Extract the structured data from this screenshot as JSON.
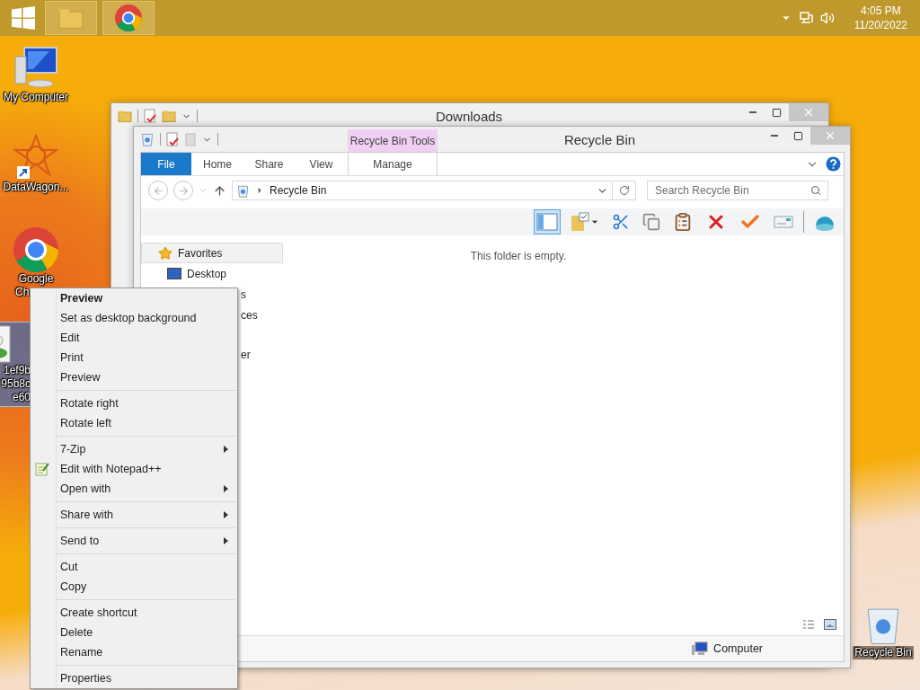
{
  "taskbar": {
    "buttons": [
      {
        "kind": "start"
      },
      {
        "kind": "explorer"
      },
      {
        "kind": "chrome"
      }
    ],
    "clock": {
      "time": "4:05 PM",
      "date": "11/20/2022"
    }
  },
  "desktop_icons": [
    {
      "kind": "computer",
      "lines": [
        "My Computer"
      ],
      "selected": false
    },
    {
      "kind": "app-shortcut",
      "lines": [
        "DataWagon..."
      ],
      "selected": false
    },
    {
      "kind": "chrome",
      "lines": [
        "Google",
        "Ch"
      ],
      "selected": false
    },
    {
      "kind": "image",
      "lines": [
        "1ef9b",
        "95b8c",
        "e60"
      ],
      "selected": true
    },
    {
      "kind": "recycle-bin",
      "lines": [
        "Recycle Bin"
      ],
      "selected": false
    }
  ],
  "downloads_window": {
    "title": "Downloads"
  },
  "recycle_bin_window": {
    "title": "Recycle Bin",
    "contextual_group": "Recycle Bin Tools",
    "tabs": [
      {
        "label": "File",
        "selected": true
      },
      {
        "label": "Home",
        "selected": false
      },
      {
        "label": "Share",
        "selected": false
      },
      {
        "label": "View",
        "selected": false
      },
      {
        "label": "Manage",
        "selected": false
      }
    ],
    "address": "Recycle Bin",
    "search": {
      "placeholder": "Search Recycle Bin"
    },
    "nav_items": [
      {
        "label": "Favorites",
        "kind": "group",
        "selected": true
      },
      {
        "label": "Desktop",
        "kind": "item",
        "selected": false
      },
      {
        "label": "s",
        "kind": "partial",
        "selected": false
      },
      {
        "label": "ces",
        "kind": "partial",
        "selected": false
      },
      {
        "label": "er",
        "kind": "partial",
        "selected": false
      }
    ],
    "empty_message": "This folder is empty.",
    "status": "Computer"
  },
  "context_menu": [
    {
      "kind": "item",
      "label": "Preview",
      "bold": true,
      "submenu": false
    },
    {
      "kind": "item",
      "label": "Set as desktop background",
      "bold": false,
      "submenu": false
    },
    {
      "kind": "item",
      "label": "Edit",
      "bold": false,
      "submenu": false
    },
    {
      "kind": "item",
      "label": "Print",
      "bold": false,
      "submenu": false
    },
    {
      "kind": "item",
      "label": "Preview",
      "bold": false,
      "submenu": false
    },
    {
      "kind": "separator"
    },
    {
      "kind": "item",
      "label": "Rotate right",
      "bold": false,
      "submenu": false
    },
    {
      "kind": "item",
      "label": "Rotate left",
      "bold": false,
      "submenu": false
    },
    {
      "kind": "separator"
    },
    {
      "kind": "item",
      "label": "7-Zip",
      "bold": false,
      "submenu": true
    },
    {
      "kind": "item-with-icon",
      "label": "Edit with Notepad++",
      "bold": false,
      "submenu": false
    },
    {
      "kind": "item",
      "label": "Open with",
      "bold": false,
      "submenu": true
    },
    {
      "kind": "separator"
    },
    {
      "kind": "item",
      "label": "Share with",
      "bold": false,
      "submenu": true
    },
    {
      "kind": "separator"
    },
    {
      "kind": "item",
      "label": "Send to",
      "bold": false,
      "submenu": true
    },
    {
      "kind": "separator"
    },
    {
      "kind": "item",
      "label": "Cut",
      "bold": false,
      "submenu": false
    },
    {
      "kind": "item",
      "label": "Copy",
      "bold": false,
      "submenu": false
    },
    {
      "kind": "separator"
    },
    {
      "kind": "item",
      "label": "Create shortcut",
      "bold": false,
      "submenu": false
    },
    {
      "kind": "item",
      "label": "Delete",
      "bold": false,
      "submenu": false
    },
    {
      "kind": "item",
      "label": "Rename",
      "bold": false,
      "submenu": false
    },
    {
      "kind": "separator"
    },
    {
      "kind": "item",
      "label": "Properties",
      "bold": false,
      "submenu": false
    }
  ]
}
